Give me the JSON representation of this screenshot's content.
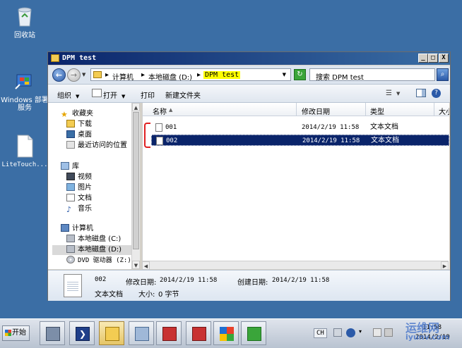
{
  "desktop": {
    "icons": [
      {
        "label": "回收站"
      },
      {
        "label": "Windows 部署服务"
      },
      {
        "label": "LiteTouch..."
      }
    ]
  },
  "window": {
    "title": "DPM test",
    "caption_buttons": {
      "minimize": "_",
      "maximize": "□",
      "close": "X"
    }
  },
  "address": {
    "crumbs": [
      "计算机",
      "本地磁盘 (D:)",
      "DPM test"
    ],
    "separator": "▸",
    "search_placeholder": "搜索 DPM test"
  },
  "toolbar": {
    "organize": "组织",
    "open": "打开",
    "print": "打印",
    "new_folder": "新建文件夹"
  },
  "nav": {
    "favorites": "收藏夹",
    "downloads": "下载",
    "desktop": "桌面",
    "recent": "最近访问的位置",
    "libraries": "库",
    "videos": "视频",
    "pictures": "图片",
    "documents": "文档",
    "music": "音乐",
    "computer": "计算机",
    "drive_c": "本地磁盘 (C:)",
    "drive_d": "本地磁盘 (D:)",
    "dvd": "DVD 驱动器 (Z:)"
  },
  "columns": {
    "name": "名称",
    "modified": "修改日期",
    "type": "类型",
    "size": "大小"
  },
  "files": [
    {
      "name": "001",
      "modified": "2014/2/19 11:58",
      "type": "文本文档",
      "selected": false
    },
    {
      "name": "002",
      "modified": "2014/2/19 11:58",
      "type": "文本文档",
      "selected": true
    }
  ],
  "details": {
    "name": "002",
    "type": "文本文档",
    "modified_label": "修改日期:",
    "modified_value": "2014/2/19 11:58",
    "created_label": "创建日期:",
    "created_value": "2014/2/19 11:58",
    "size_label": "大小:",
    "size_value": "0 字节"
  },
  "taskbar": {
    "start": "开始",
    "lang": "CH",
    "time": "11:58",
    "date": "2014/2/19"
  },
  "watermark": {
    "text": "运维网",
    "sub": "iyunv.com"
  },
  "colors": {
    "title_bar": "#0a246a",
    "selection": "#0a246a",
    "desktop": "#3b6ea5"
  }
}
